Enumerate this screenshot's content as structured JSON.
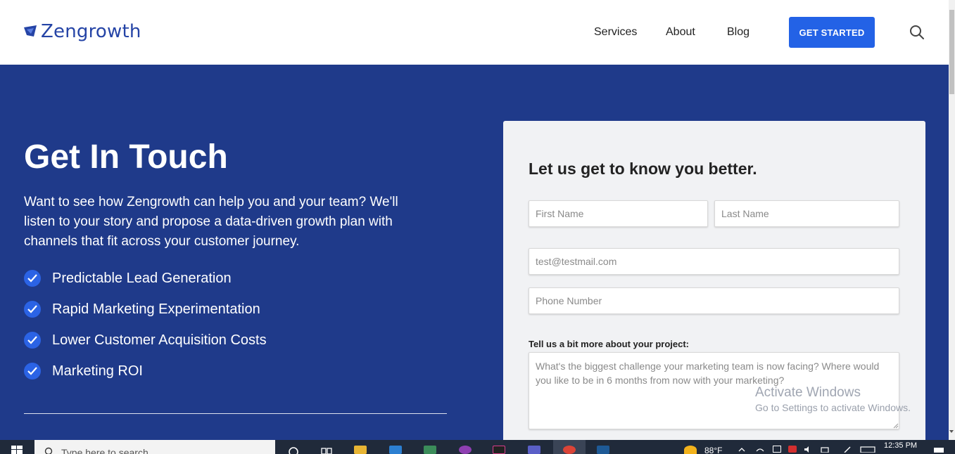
{
  "header": {
    "logo_text": "Zengrowth",
    "nav": [
      "Services",
      "About",
      "Blog"
    ],
    "cta_label": "GET STARTED",
    "search_icon": "search-icon"
  },
  "hero": {
    "title": "Get In Touch",
    "description": "Want to see how Zengrowth can help you and your team? We'll listen to your story and propose a data-driven growth plan with channels that fit across your customer journey.",
    "benefits": [
      "Predictable Lead Generation",
      "Rapid Marketing Experimentation",
      "Lower Customer Acquisition Costs",
      "Marketing ROI"
    ]
  },
  "form": {
    "title": "Let us get to know you better.",
    "first_name_placeholder": "First Name",
    "last_name_placeholder": "Last Name",
    "email_placeholder": "test@testmail.com",
    "phone_placeholder": "Phone Number",
    "project_label": "Tell us a bit more about your project:",
    "project_placeholder": "What's the biggest challenge your marketing team is now facing? Where would you like to be in 6 months from now with your marketing?"
  },
  "watermark": {
    "line1": "Activate Windows",
    "line2": "Go to Settings to activate Windows."
  },
  "taskbar": {
    "search_placeholder": "Type here to search",
    "weather": "88°F",
    "clock": "12:35 PM"
  },
  "colors": {
    "brand_blue": "#1f3a8a",
    "cta_blue": "#2362e6",
    "logo_blue": "#2544a6"
  }
}
